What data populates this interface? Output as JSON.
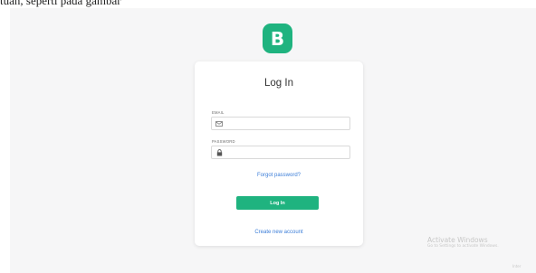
{
  "document": {
    "caption": "tuan, seperti pada gambar"
  },
  "logo": {
    "letter": "B",
    "color": "#1fb37f"
  },
  "login_card": {
    "title": "Log In",
    "email": {
      "label": "EMAIL",
      "value": "",
      "icon": "envelope-icon"
    },
    "password": {
      "label": "PASSWORD",
      "value": "",
      "icon": "lock-icon"
    },
    "forgot_password_link": "Forgot password?",
    "login_button": "Log In",
    "create_account_link": "Create new account"
  },
  "watermark": {
    "title": "Activate Windows",
    "subtitle": "Go to Settings to activate Windows.",
    "tag": "Inter"
  },
  "colors": {
    "accent": "#1fb37f",
    "link": "#3b7dd8",
    "background": "#f6f6f7"
  }
}
